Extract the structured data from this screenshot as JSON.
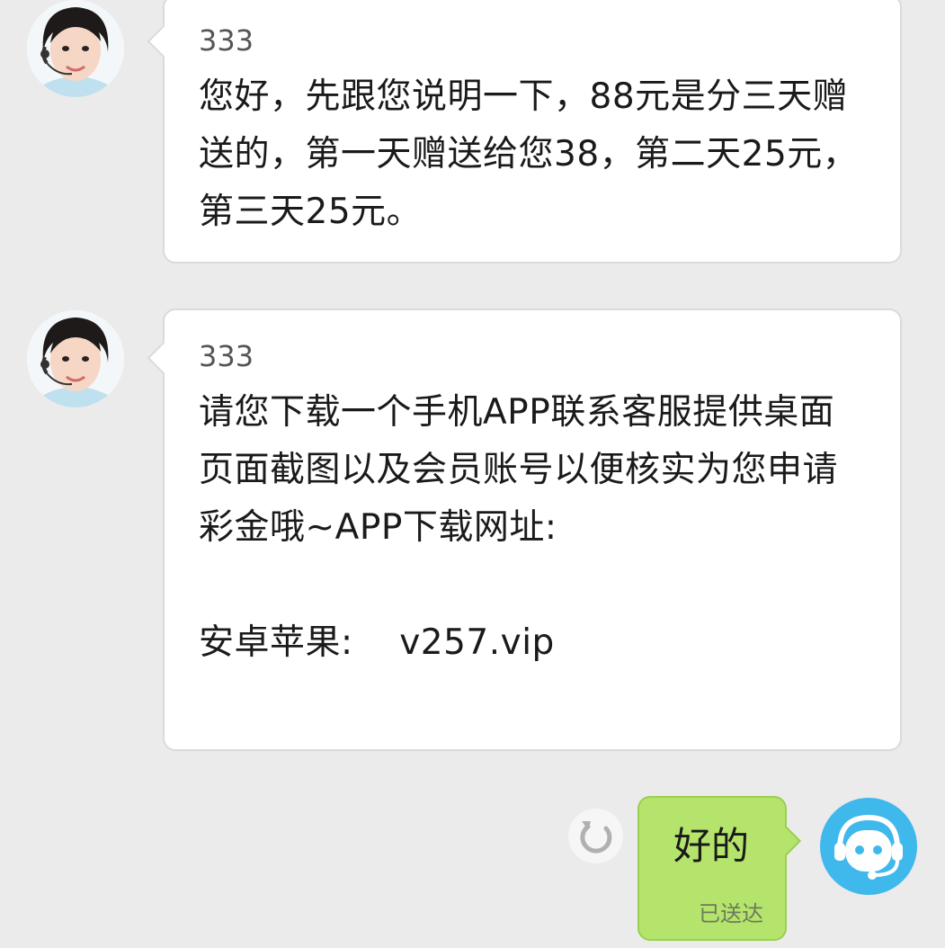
{
  "messages": [
    {
      "sender": "333",
      "text": "您好，先跟您说明一下，88元是分三天赠送的，第一天赠送给您38，第二天25元，第三天25元。"
    },
    {
      "sender": "333",
      "text": "请您下载一个手机APP联系客服提供桌面页面截图以及会员账号以便核实为您申请彩金哦~APP下载网址:\n\n安卓苹果:    v257.vip"
    }
  ],
  "outgoing": {
    "text": "好的",
    "status": "已送达"
  },
  "icons": {
    "retry": "retry-icon",
    "agent_avatar": "headset-agent-icon",
    "sender_avatar": "customer-service-avatar"
  },
  "colors": {
    "background": "#ebebeb",
    "incoming_bubble": "#ffffff",
    "outgoing_bubble": "#b5e46c",
    "agent_avatar": "#3fb8ec"
  }
}
